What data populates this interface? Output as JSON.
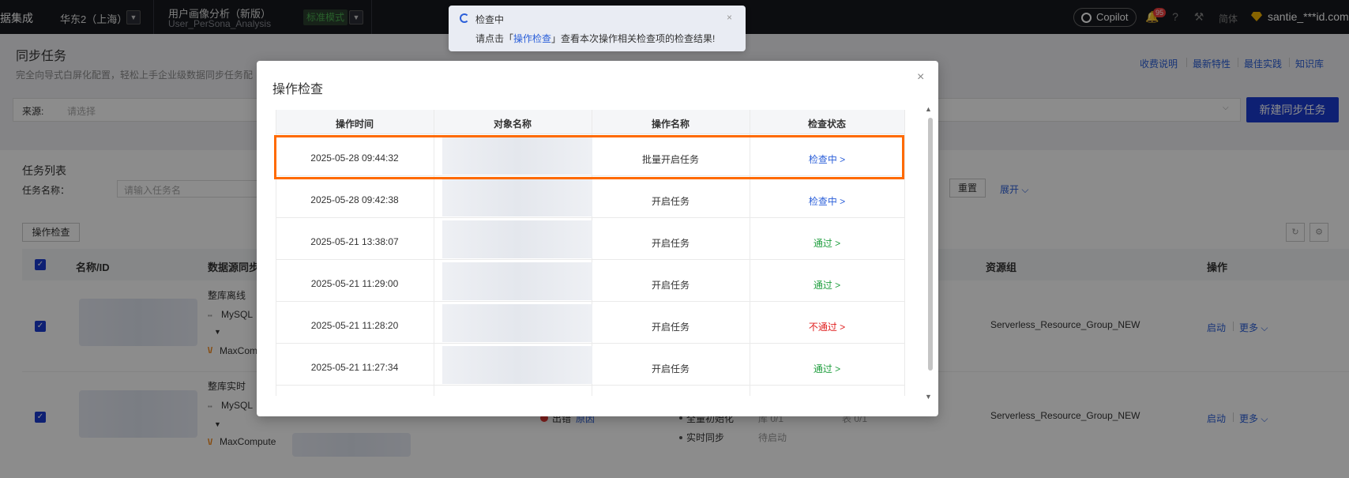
{
  "topbar": {
    "brand": "据集成",
    "region": "华东2（上海）",
    "workspace_name": "用户画像分析（新版）",
    "workspace_id": "User_PerSona_Analysis",
    "mode": "标准模式",
    "copilot": "Copilot",
    "notification_count": "95",
    "lang": "简体",
    "user": "santie_***id.com"
  },
  "page": {
    "title": "同步任务",
    "description": "完全向导式白屏化配置，轻松上手企业级数据同步任务配",
    "links": [
      "收费说明",
      "最新特性",
      "最佳实践",
      "知识库"
    ],
    "source_label": "来源:",
    "source_placeholder": "请选择",
    "new_button": "新建同步任务"
  },
  "task_list": {
    "title": "任务列表",
    "filter_label": "任务名称：",
    "filter_placeholder": "请输入任务名",
    "reset": "重置",
    "expand": "展开",
    "op_check": "操作检查",
    "columns": {
      "name": "名称/ID",
      "source": "数据源同步",
      "resource_group": "资源组",
      "action": "操作"
    },
    "rows": [
      {
        "type": "整库离线",
        "source": "MySQL",
        "target": "MaxCom",
        "resource_group": "Serverless_Resource_Group_NEW",
        "start": "启动",
        "more": "更多"
      },
      {
        "type": "整库实时",
        "source": "MySQL",
        "target": "MaxCompute",
        "status_fail": "出错",
        "status_reason": "原因",
        "stage_full": "全量初始化",
        "stage_full_val": "库 0/1",
        "stage_full_val2": "表 0/1",
        "stage_realtime": "实时同步",
        "stage_realtime_val": "待启动",
        "resource_group": "Serverless_Resource_Group_NEW",
        "start": "启动",
        "more": "更多"
      }
    ]
  },
  "toast": {
    "title": "检查中",
    "msg_prefix": "请点击「",
    "msg_link": "操作检查",
    "msg_suffix": "」查看本次操作相关检查项的检查结果!"
  },
  "modal": {
    "title": "操作检查",
    "columns": [
      "操作时间",
      "对象名称",
      "操作名称",
      "检查状态"
    ],
    "rows": [
      {
        "time": "2025-05-28 09:44:32",
        "op": "批量开启任务",
        "status": "检查中 >",
        "kind": "checking"
      },
      {
        "time": "2025-05-28 09:42:38",
        "op": "开启任务",
        "status": "检查中 >",
        "kind": "checking"
      },
      {
        "time": "2025-05-21 13:38:07",
        "op": "开启任务",
        "status": "通过 >",
        "kind": "pass"
      },
      {
        "time": "2025-05-21 11:29:00",
        "op": "开启任务",
        "status": "通过 >",
        "kind": "pass"
      },
      {
        "time": "2025-05-21 11:28:20",
        "op": "开启任务",
        "status": "不通过 >",
        "kind": "fail"
      },
      {
        "time": "2025-05-21 11:27:34",
        "op": "开启任务",
        "status": "通过 >",
        "kind": "pass"
      }
    ]
  },
  "colors": {
    "accent": "#1b3bd1",
    "link": "#2b5fd9",
    "pass": "#1f9e3e",
    "fail": "#e02020",
    "highlight": "#ff6a00"
  }
}
